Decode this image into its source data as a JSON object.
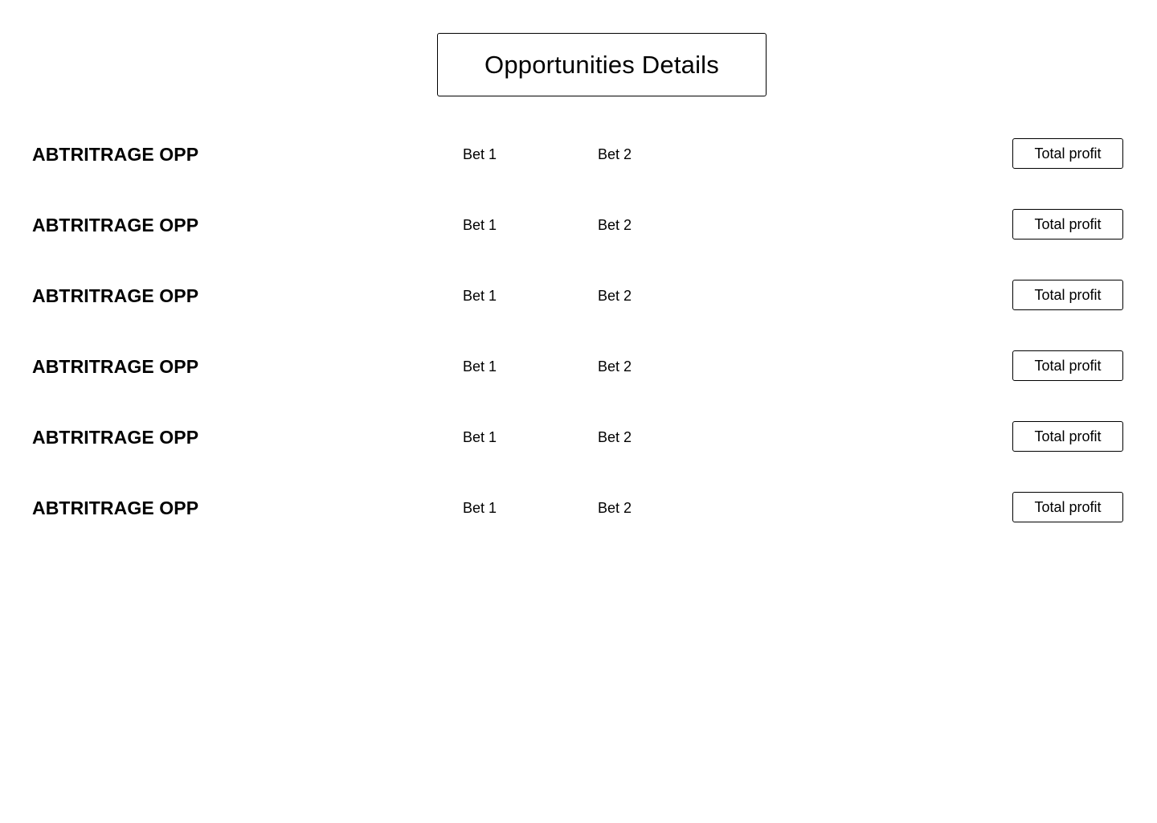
{
  "header": {
    "title": "Opportunities Details"
  },
  "rows": [
    {
      "name": "ABTRITRAGE OPP",
      "bet1": "Bet 1",
      "bet2": "Bet 2",
      "profit_label": "Total profit"
    },
    {
      "name": "ABTRITRAGE OPP",
      "bet1": "Bet 1",
      "bet2": "Bet 2",
      "profit_label": "Total profit"
    },
    {
      "name": "ABTRITRAGE OPP",
      "bet1": "Bet 1",
      "bet2": "Bet 2",
      "profit_label": "Total profit"
    },
    {
      "name": "ABTRITRAGE OPP",
      "bet1": "Bet 1",
      "bet2": "Bet 2",
      "profit_label": "Total profit"
    },
    {
      "name": "ABTRITRAGE OPP",
      "bet1": "Bet 1",
      "bet2": "Bet 2",
      "profit_label": "Total profit"
    },
    {
      "name": "ABTRITRAGE OPP",
      "bet1": "Bet 1",
      "bet2": "Bet 2",
      "profit_label": "Total profit"
    }
  ],
  "colors": {
    "background": "#ffffff",
    "text": "#000000",
    "border": "#000000"
  }
}
